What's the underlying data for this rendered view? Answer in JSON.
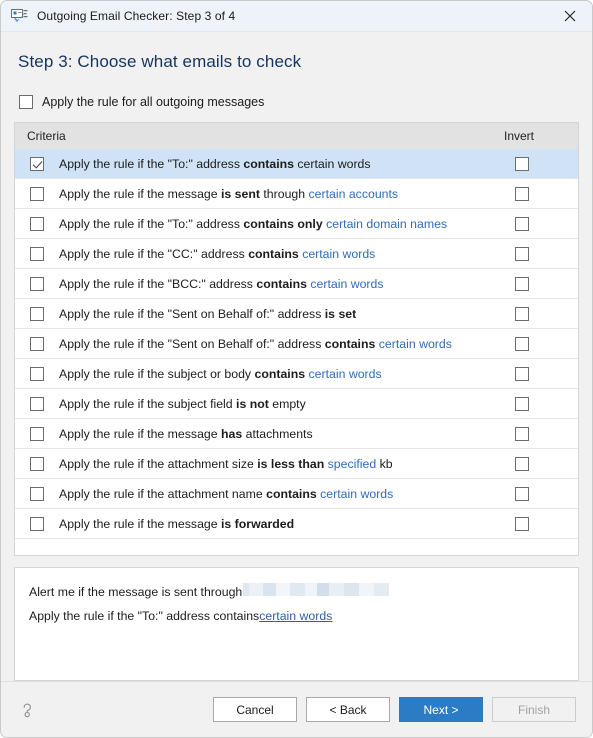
{
  "window": {
    "title": "Outgoing Email Checker: Step 3 of 4",
    "app_icon": "email-check-icon",
    "close_icon": "close-icon",
    "accent_color": "#2b7cc4",
    "selection_color": "#cfe2f6",
    "link_color": "#2f6bbd"
  },
  "step": {
    "heading": "Step 3: Choose what emails to check"
  },
  "all_messages": {
    "label": "Apply the rule for all outgoing messages",
    "checked": false
  },
  "table": {
    "columns": {
      "criteria": "Criteria",
      "invert": "Invert"
    },
    "rows": [
      {
        "text": "Apply the rule if the \"To:\" address contains certain words",
        "parts": [
          {
            "t": "Apply the rule if the \"To:\" address ",
            "s": "normal"
          },
          {
            "t": "contains",
            "s": "bold"
          },
          {
            "t": " certain words",
            "s": "normal"
          }
        ],
        "checked": true,
        "invert": false,
        "selected": true
      },
      {
        "text": "Apply the rule if the message is sent through certain accounts",
        "parts": [
          {
            "t": "Apply the rule if the message ",
            "s": "normal"
          },
          {
            "t": "is sent",
            "s": "bold"
          },
          {
            "t": " through ",
            "s": "normal"
          },
          {
            "t": "certain accounts",
            "s": "link"
          }
        ],
        "checked": false,
        "invert": false,
        "selected": false
      },
      {
        "text": "Apply the rule if the \"To:\" address contains only certain domain names",
        "parts": [
          {
            "t": "Apply the rule if the \"To:\" address ",
            "s": "normal"
          },
          {
            "t": "contains only",
            "s": "bold"
          },
          {
            "t": " ",
            "s": "normal"
          },
          {
            "t": "certain domain names",
            "s": "link"
          }
        ],
        "checked": false,
        "invert": false,
        "selected": false
      },
      {
        "text": "Apply the rule if the \"CC:\" address contains certain words",
        "parts": [
          {
            "t": "Apply the rule if the \"CC:\" address ",
            "s": "normal"
          },
          {
            "t": "contains",
            "s": "bold"
          },
          {
            "t": " ",
            "s": "normal"
          },
          {
            "t": "certain words",
            "s": "link"
          }
        ],
        "checked": false,
        "invert": false,
        "selected": false
      },
      {
        "text": "Apply the rule if the \"BCC:\" address contains certain words",
        "parts": [
          {
            "t": "Apply the rule if the \"BCC:\" address ",
            "s": "normal"
          },
          {
            "t": "contains",
            "s": "bold"
          },
          {
            "t": " ",
            "s": "normal"
          },
          {
            "t": "certain words",
            "s": "link"
          }
        ],
        "checked": false,
        "invert": false,
        "selected": false
      },
      {
        "text": "Apply the rule if the \"Sent on Behalf of:\" address is set",
        "parts": [
          {
            "t": "Apply the rule if the \"Sent on Behalf of:\" address ",
            "s": "normal"
          },
          {
            "t": "is set",
            "s": "bold"
          }
        ],
        "checked": false,
        "invert": false,
        "selected": false
      },
      {
        "text": "Apply the rule if the \"Sent on Behalf of:\" address contains certain words",
        "parts": [
          {
            "t": "Apply the rule if the \"Sent on Behalf of:\" address ",
            "s": "normal"
          },
          {
            "t": "contains",
            "s": "bold"
          },
          {
            "t": " ",
            "s": "normal"
          },
          {
            "t": "certain words",
            "s": "link"
          }
        ],
        "checked": false,
        "invert": false,
        "selected": false
      },
      {
        "text": "Apply the rule if the subject or body contains certain words",
        "parts": [
          {
            "t": "Apply the rule if the subject or body ",
            "s": "normal"
          },
          {
            "t": "contains",
            "s": "bold"
          },
          {
            "t": " ",
            "s": "normal"
          },
          {
            "t": "certain words",
            "s": "link"
          }
        ],
        "checked": false,
        "invert": false,
        "selected": false
      },
      {
        "text": "Apply the rule if the subject field is not empty",
        "parts": [
          {
            "t": "Apply the rule if the subject field ",
            "s": "normal"
          },
          {
            "t": "is not",
            "s": "bold"
          },
          {
            "t": " empty",
            "s": "normal"
          }
        ],
        "checked": false,
        "invert": false,
        "selected": false
      },
      {
        "text": "Apply the rule if the message has attachments",
        "parts": [
          {
            "t": "Apply the rule if the message ",
            "s": "normal"
          },
          {
            "t": "has",
            "s": "bold"
          },
          {
            "t": " attachments",
            "s": "normal"
          }
        ],
        "checked": false,
        "invert": false,
        "selected": false
      },
      {
        "text": "Apply the rule if the attachment size is less than specified kb",
        "parts": [
          {
            "t": "Apply the rule if the attachment size ",
            "s": "normal"
          },
          {
            "t": "is less than",
            "s": "bold"
          },
          {
            "t": " ",
            "s": "normal"
          },
          {
            "t": "specified",
            "s": "link"
          },
          {
            "t": " kb",
            "s": "normal"
          }
        ],
        "checked": false,
        "invert": false,
        "selected": false
      },
      {
        "text": "Apply the rule if the attachment name contains certain words",
        "parts": [
          {
            "t": "Apply the rule if the attachment name ",
            "s": "normal"
          },
          {
            "t": "contains",
            "s": "bold"
          },
          {
            "t": " ",
            "s": "normal"
          },
          {
            "t": "certain words",
            "s": "link"
          }
        ],
        "checked": false,
        "invert": false,
        "selected": false
      },
      {
        "text": "Apply the rule if the message is forwarded",
        "parts": [
          {
            "t": "Apply the rule if the message ",
            "s": "normal"
          },
          {
            "t": "is forwarded",
            "s": "bold"
          }
        ],
        "checked": false,
        "invert": false,
        "selected": false
      }
    ]
  },
  "summary": {
    "line1": {
      "prefix": "Alert me if the message is sent through ",
      "redacted": true,
      "suffix": ""
    },
    "line2": {
      "prefix": "Apply the rule if the \"To:\" address contains ",
      "link": "certain words"
    }
  },
  "footer": {
    "help_icon": "help-question-icon",
    "buttons": [
      {
        "label": "Cancel",
        "style": "normal",
        "name": "cancel-button"
      },
      {
        "label": "< Back",
        "style": "normal",
        "name": "back-button"
      },
      {
        "label": "Next >",
        "style": "primary",
        "name": "next-button"
      },
      {
        "label": "Finish",
        "style": "disabled",
        "name": "finish-button"
      }
    ]
  }
}
